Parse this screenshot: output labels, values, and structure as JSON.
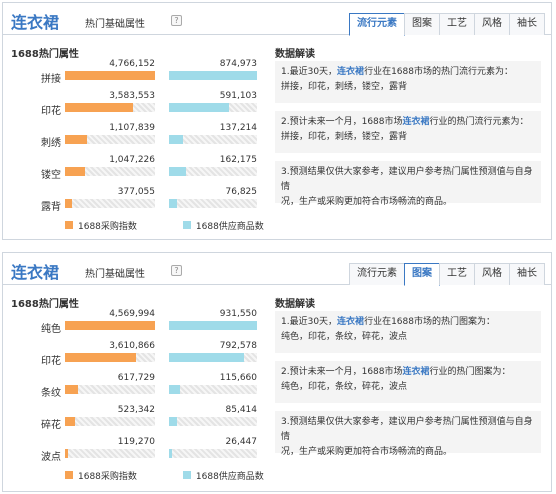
{
  "panels": [
    {
      "title": "连衣裙",
      "subtitle": "热门基础属性",
      "help": "?",
      "tabs": [
        {
          "label": "流行元素",
          "active": true
        },
        {
          "label": "图案",
          "active": false
        },
        {
          "label": "工艺",
          "active": false
        },
        {
          "label": "风格",
          "active": false
        },
        {
          "label": "袖长",
          "active": false
        }
      ],
      "section_title": "1688热门属性",
      "rows": [
        {
          "label": "拼接",
          "purchase": "4,766,152",
          "supply": "874,973",
          "purchase_ratio": 1.0,
          "supply_ratio": 1.0
        },
        {
          "label": "印花",
          "purchase": "3,583,553",
          "supply": "591,103",
          "purchase_ratio": 0.75,
          "supply_ratio": 0.68
        },
        {
          "label": "刺绣",
          "purchase": "1,107,839",
          "supply": "137,214",
          "purchase_ratio": 0.24,
          "supply_ratio": 0.16
        },
        {
          "label": "镂空",
          "purchase": "1,047,226",
          "supply": "162,175",
          "purchase_ratio": 0.22,
          "supply_ratio": 0.19
        },
        {
          "label": "露背",
          "purchase": "377,055",
          "supply": "76,825",
          "purchase_ratio": 0.08,
          "supply_ratio": 0.09
        }
      ],
      "legend": {
        "purchase": "1688采购指数",
        "supply": "1688供应商品数"
      },
      "analysis_title": "数据解读",
      "notes": [
        {
          "pre": "1.最近30天，",
          "hl": "连衣裙",
          "post": "行业在1688市场的热门流行元素为：",
          "line2": "拼接，印花，刺绣，镂空，露背"
        },
        {
          "pre": "2.预计未来一个月，1688市场",
          "hl": "连衣裙",
          "post": "行业的热门流行元素为：",
          "line2": "拼接，印花，刺绣，镂空，露背"
        },
        {
          "pre": "3.预测结果仅供大家参考，建议用户参考热门属性预测值与自身情",
          "hl": "",
          "post": "",
          "line2": "况，生产或采购更加符合市场畅流的商品。"
        }
      ]
    },
    {
      "title": "连衣裙",
      "subtitle": "热门基础属性",
      "help": "?",
      "tabs": [
        {
          "label": "流行元素",
          "active": false
        },
        {
          "label": "图案",
          "active": true
        },
        {
          "label": "工艺",
          "active": false
        },
        {
          "label": "风格",
          "active": false
        },
        {
          "label": "袖长",
          "active": false
        }
      ],
      "section_title": "1688热门属性",
      "rows": [
        {
          "label": "纯色",
          "purchase": "4,569,994",
          "supply": "931,550",
          "purchase_ratio": 1.0,
          "supply_ratio": 1.0
        },
        {
          "label": "印花",
          "purchase": "3,610,866",
          "supply": "792,578",
          "purchase_ratio": 0.79,
          "supply_ratio": 0.85
        },
        {
          "label": "条纹",
          "purchase": "617,729",
          "supply": "115,660",
          "purchase_ratio": 0.14,
          "supply_ratio": 0.12
        },
        {
          "label": "碎花",
          "purchase": "523,342",
          "supply": "85,414",
          "purchase_ratio": 0.11,
          "supply_ratio": 0.09
        },
        {
          "label": "波点",
          "purchase": "119,270",
          "supply": "26,447",
          "purchase_ratio": 0.03,
          "supply_ratio": 0.03
        }
      ],
      "legend": {
        "purchase": "1688采购指数",
        "supply": "1688供应商品数"
      },
      "analysis_title": "数据解读",
      "notes": [
        {
          "pre": "1.最近30天，",
          "hl": "连衣裙",
          "post": "行业在1688市场的热门图案为：",
          "line2": "纯色，印花，条纹，碎花，波点"
        },
        {
          "pre": "2.预计未来一个月，1688市场",
          "hl": "连衣裙",
          "post": "行业的热门图案为：",
          "line2": "纯色，印花，条纹，碎花，波点"
        },
        {
          "pre": "3.预测结果仅供大家参考，建议用户参考热门属性预测值与自身情",
          "hl": "",
          "post": "",
          "line2": "况，生产或采购更加符合市场畅流的商品。"
        }
      ]
    }
  ]
}
